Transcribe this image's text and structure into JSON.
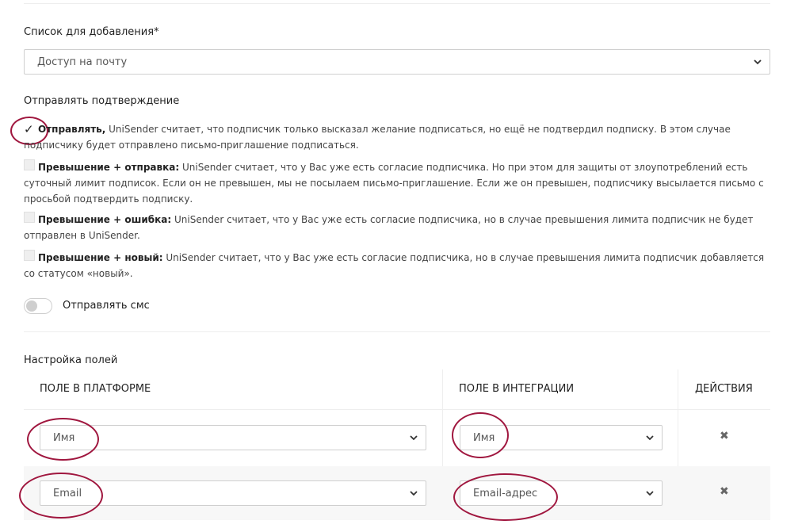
{
  "list_section": {
    "label": "Список для добавления*",
    "selected": "Доступ на почту"
  },
  "confirm_section": {
    "label": "Отправлять подтверждение",
    "options": [
      {
        "title": "Отправлять,",
        "text": " UniSender считает, что подписчик только высказал желание подписаться, но ещё не подтвердил подписку. В этом случае подписчику будет отправлено письмо-приглашение подписаться.",
        "checked": true
      },
      {
        "title": "Превышение + отправка:",
        "text": " UniSender считает, что у Вас уже есть согласие подписчика. Но при этом для защиты от злоупотреблений есть суточный лимит подписок. Если он не превышен, мы не посылаем письмо-приглашение. Если же он превышен, подписчику высылается письмо с просьбой подтвердить подписку.",
        "checked": false
      },
      {
        "title": "Превышение + ошибка:",
        "text": " UniSender считает, что у Вас уже есть согласие подписчика, но в случае превышения лимита подписчик не будет отправлен в UniSender.",
        "checked": false
      },
      {
        "title": "Превышение + новый:",
        "text": " UniSender считает, что у Вас уже есть согласие подписчика, но в случае превышения лимита подписчик добавляется со статусом «новый».",
        "checked": false
      }
    ]
  },
  "sms": {
    "label": "Отправлять смс",
    "enabled": false
  },
  "fields_section": {
    "label": "Настройка полей",
    "headers": {
      "platform": "ПОЛЕ В ПЛАТФОРМЕ",
      "integration": "ПОЛЕ В ИНТЕГРАЦИИ",
      "actions": "ДЕЙСТВИЯ"
    },
    "rows": [
      {
        "platform": "Имя",
        "integration": "Имя",
        "action_icon": "close-icon"
      },
      {
        "platform": "Email",
        "integration": "Email-адрес",
        "action_icon": "close-icon"
      }
    ]
  },
  "colors": {
    "highlight_ring": "#a0173f",
    "row_alt_bg": "#f7f7f7",
    "border": "#cfcfcf"
  },
  "icons": {
    "select_arrow": "chevron-down-icon",
    "check": "checkmark-icon",
    "delete": "close-icon"
  }
}
